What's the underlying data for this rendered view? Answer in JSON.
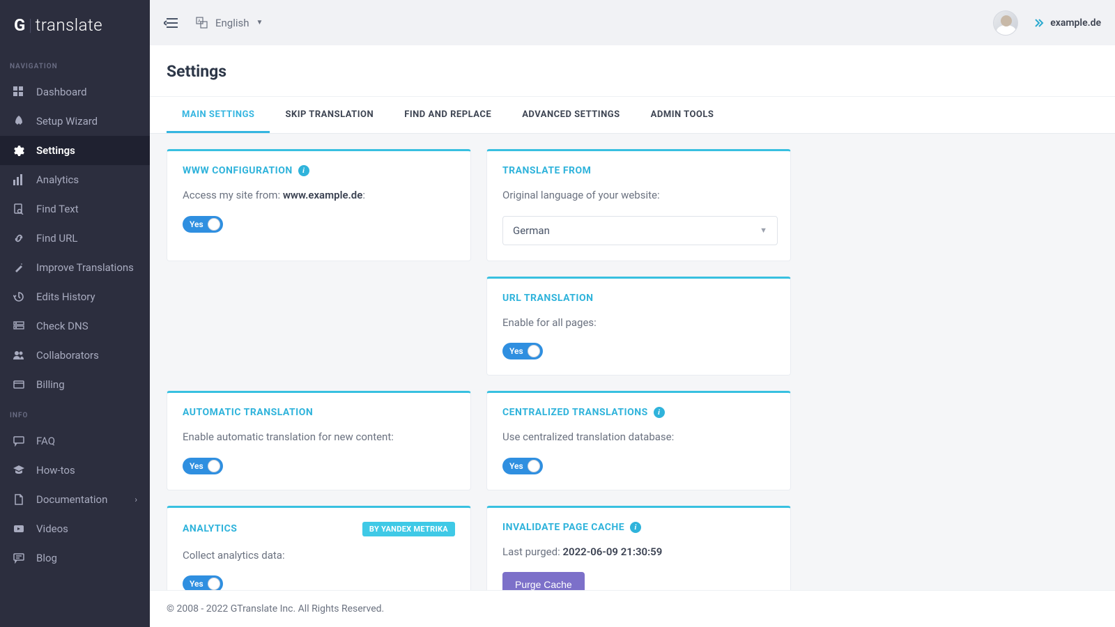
{
  "brand": {
    "prefix": "G",
    "suffix": "translate"
  },
  "header": {
    "language": "English",
    "site": "example.de"
  },
  "sidebar": {
    "nav_title": "NAVIGATION",
    "info_title": "INFO",
    "items": [
      {
        "label": "Dashboard",
        "icon": "dashboard-icon"
      },
      {
        "label": "Setup Wizard",
        "icon": "rocket-icon"
      },
      {
        "label": "Settings",
        "icon": "gear-icon",
        "active": true
      },
      {
        "label": "Analytics",
        "icon": "bar-chart-icon"
      },
      {
        "label": "Find Text",
        "icon": "search-doc-icon"
      },
      {
        "label": "Find URL",
        "icon": "link-icon"
      },
      {
        "label": "Improve Translations",
        "icon": "wand-icon"
      },
      {
        "label": "Edits History",
        "icon": "history-icon"
      },
      {
        "label": "Check DNS",
        "icon": "server-icon"
      },
      {
        "label": "Collaborators",
        "icon": "users-icon"
      },
      {
        "label": "Billing",
        "icon": "card-icon"
      }
    ],
    "info_items": [
      {
        "label": "FAQ",
        "icon": "chat-icon"
      },
      {
        "label": "How-tos",
        "icon": "grad-cap-icon"
      },
      {
        "label": "Documentation",
        "icon": "doc-icon",
        "expandable": true
      },
      {
        "label": "Videos",
        "icon": "play-icon"
      },
      {
        "label": "Blog",
        "icon": "message-icon"
      }
    ]
  },
  "page": {
    "title": "Settings"
  },
  "tabs": [
    {
      "label": "MAIN SETTINGS",
      "active": true
    },
    {
      "label": "SKIP TRANSLATION"
    },
    {
      "label": "FIND AND REPLACE"
    },
    {
      "label": "ADVANCED SETTINGS"
    },
    {
      "label": "ADMIN TOOLS"
    }
  ],
  "cards": {
    "www": {
      "title": "WWW CONFIGURATION",
      "desc_prefix": "Access my site from: ",
      "domain": "www.example.de",
      "desc_suffix": ":",
      "toggle": "Yes"
    },
    "translate_from": {
      "title": "TRANSLATE FROM",
      "desc": "Original language of your website:",
      "value": "German"
    },
    "url_translation": {
      "title": "URL TRANSLATION",
      "desc": "Enable for all pages:",
      "toggle": "Yes"
    },
    "automatic": {
      "title": "AUTOMATIC TRANSLATION",
      "desc": "Enable automatic translation for new content:",
      "toggle": "Yes"
    },
    "centralized": {
      "title": "CENTRALIZED TRANSLATIONS",
      "desc": "Use centralized translation database:",
      "toggle": "Yes"
    },
    "analytics": {
      "title": "ANALYTICS",
      "badge": "BY YANDEX METRIKA",
      "desc": "Collect analytics data:",
      "toggle": "Yes"
    },
    "cache": {
      "title": "INVALIDATE PAGE CACHE",
      "desc_prefix": "Last purged: ",
      "timestamp": "2022-06-09 21:30:59",
      "button": "Purge Cache"
    }
  },
  "footer": {
    "text": "© 2008 - 2022 GTranslate Inc. All Rights Reserved."
  }
}
